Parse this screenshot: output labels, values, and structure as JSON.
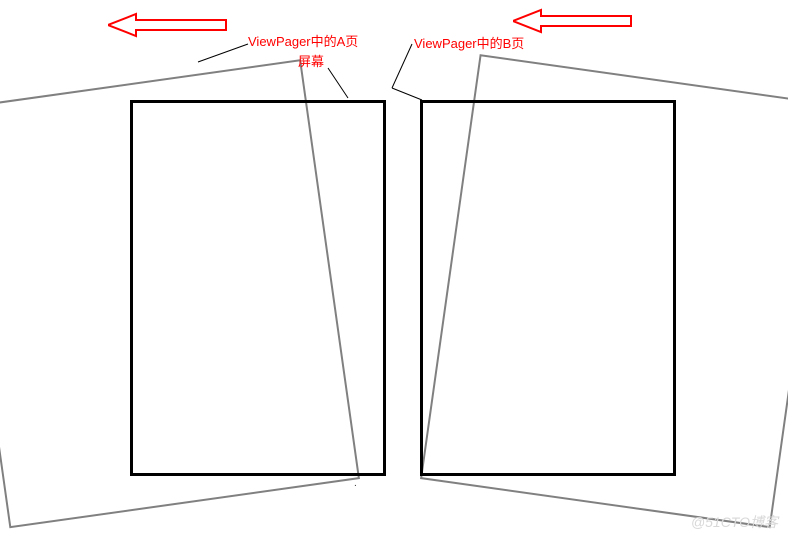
{
  "labels": {
    "page_a": "ViewPager中的A页",
    "screen": "屏幕",
    "page_b": "ViewPager中的B页"
  },
  "arrows": {
    "direction": "left",
    "color": "#ff0000"
  },
  "rectangles": {
    "screen_color": "#000000",
    "tilted_color": "#808080"
  },
  "watermark": "@51CTO博客",
  "diagram": {
    "description": "ViewPager page transition diagram showing two screens (A and B) with rotated gray outlines indicating swipe animation, red arrows pointing left indicating swipe direction"
  }
}
